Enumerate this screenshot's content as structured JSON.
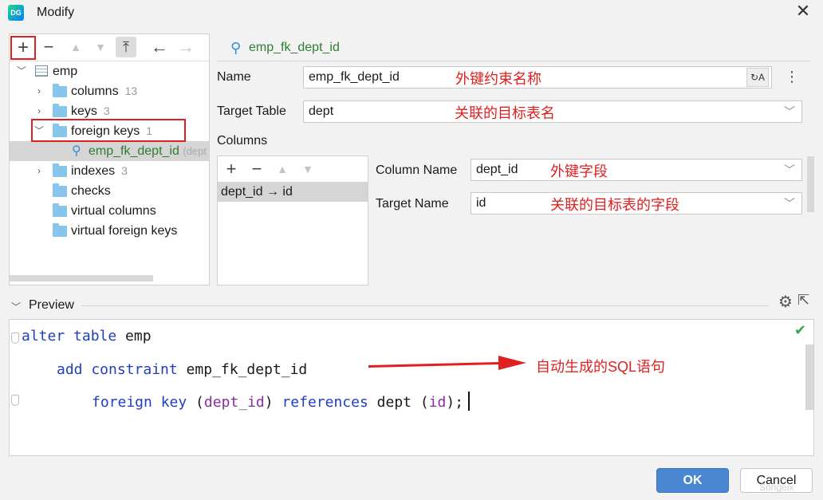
{
  "window": {
    "title": "Modify",
    "app_icon_text": "DG"
  },
  "tree": {
    "root": "emp",
    "items": [
      {
        "label": "columns",
        "count": "13"
      },
      {
        "label": "keys",
        "count": "3"
      },
      {
        "label": "foreign keys",
        "count": "1"
      },
      {
        "label": "emp_fk_dept_id",
        "suffix": "(dept"
      },
      {
        "label": "indexes",
        "count": "3"
      },
      {
        "label": "checks"
      },
      {
        "label": "virtual columns"
      },
      {
        "label": "virtual foreign keys"
      }
    ]
  },
  "header": {
    "name": "emp_fk_dept_id"
  },
  "form": {
    "name_label": "Name",
    "name_value": "emp_fk_dept_id",
    "name_anno": "外键约束名称",
    "target_table_label": "Target Table",
    "target_table_value": "dept",
    "target_table_anno": "关联的目标表名",
    "columns_label": "Columns",
    "column_mapping": "dept_id → id",
    "column_name_label": "Column Name",
    "column_name_value": "dept_id",
    "column_name_anno": "外键字段",
    "target_name_label": "Target Name",
    "target_name_value": "id",
    "target_name_anno": "关联的目标表的字段"
  },
  "preview": {
    "title": "Preview",
    "code": {
      "l1_kw": "alter table",
      "l1_rest": " emp",
      "l2_kw": "add constraint",
      "l2_rest": " emp_fk_dept_id",
      "l3_kw": "foreign key",
      "l3_p1": " (",
      "l3_id1": "dept_id",
      "l3_p2": ") ",
      "l3_kw2": "references",
      "l3_p3": " dept (",
      "l3_id2": "id",
      "l3_p4": ");"
    },
    "annotation": "自动生成的SQL语句"
  },
  "buttons": {
    "ok": "OK",
    "cancel": "Cancel"
  },
  "watermark": "Songeix"
}
